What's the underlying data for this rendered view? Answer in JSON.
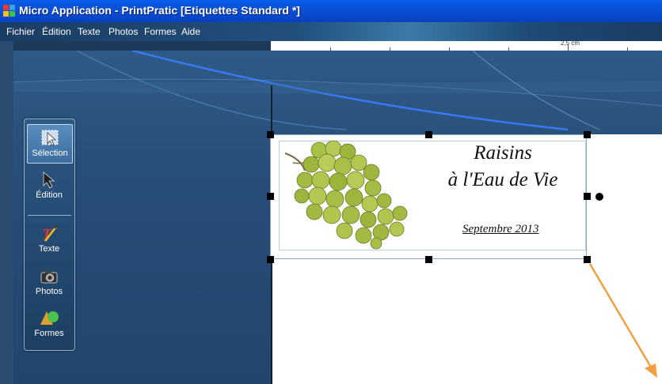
{
  "window": {
    "title": "Micro Application - PrintPratic [Etiquettes Standard *]"
  },
  "menu": [
    "Fichier",
    "Édition",
    "Texte",
    "Photos",
    "Formes",
    "Aide"
  ],
  "ruler": {
    "label": "2,5 cm"
  },
  "tools": [
    {
      "label": "Sélection",
      "icon": "selection-icon",
      "active": true
    },
    {
      "label": "Édition",
      "icon": "edit-arrow-icon",
      "active": false
    },
    {
      "label": "Texte",
      "icon": "text-icon",
      "active": false
    },
    {
      "label": "Photos",
      "icon": "camera-icon",
      "active": false
    },
    {
      "label": "Formes",
      "icon": "shapes-icon",
      "active": false
    }
  ],
  "label": {
    "line1": "Raisins",
    "line2": "à l'Eau de Vie",
    "date": "Septembre  2013"
  },
  "colors": {
    "titlebar": "#0a4fd6",
    "workarea": "#2b5580",
    "annotation_arrow": "#f0a040"
  }
}
